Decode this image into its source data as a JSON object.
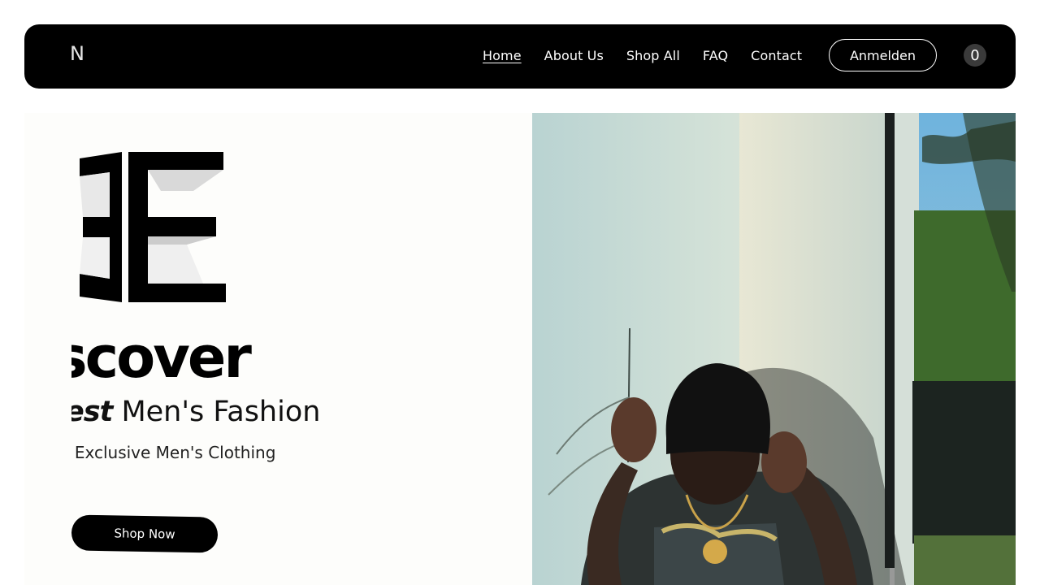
{
  "header": {
    "logo": "N",
    "nav": [
      "Home",
      "About Us",
      "Shop All",
      "FAQ",
      "Contact"
    ],
    "login_label": "Anmelden",
    "cart_count": "0"
  },
  "hero": {
    "headline": "scover",
    "subheadline_em": "est",
    "subheadline_rest": " Men's Fashion",
    "tagline": "' Exclusive Men's Clothing",
    "cta_label": "Shop Now"
  },
  "colors": {
    "header_bg": "#000000",
    "hero_bg": "#fdfdfb",
    "button_bg": "#000000"
  },
  "icons": [
    "cart-count-icon",
    "brand-e-logo"
  ]
}
